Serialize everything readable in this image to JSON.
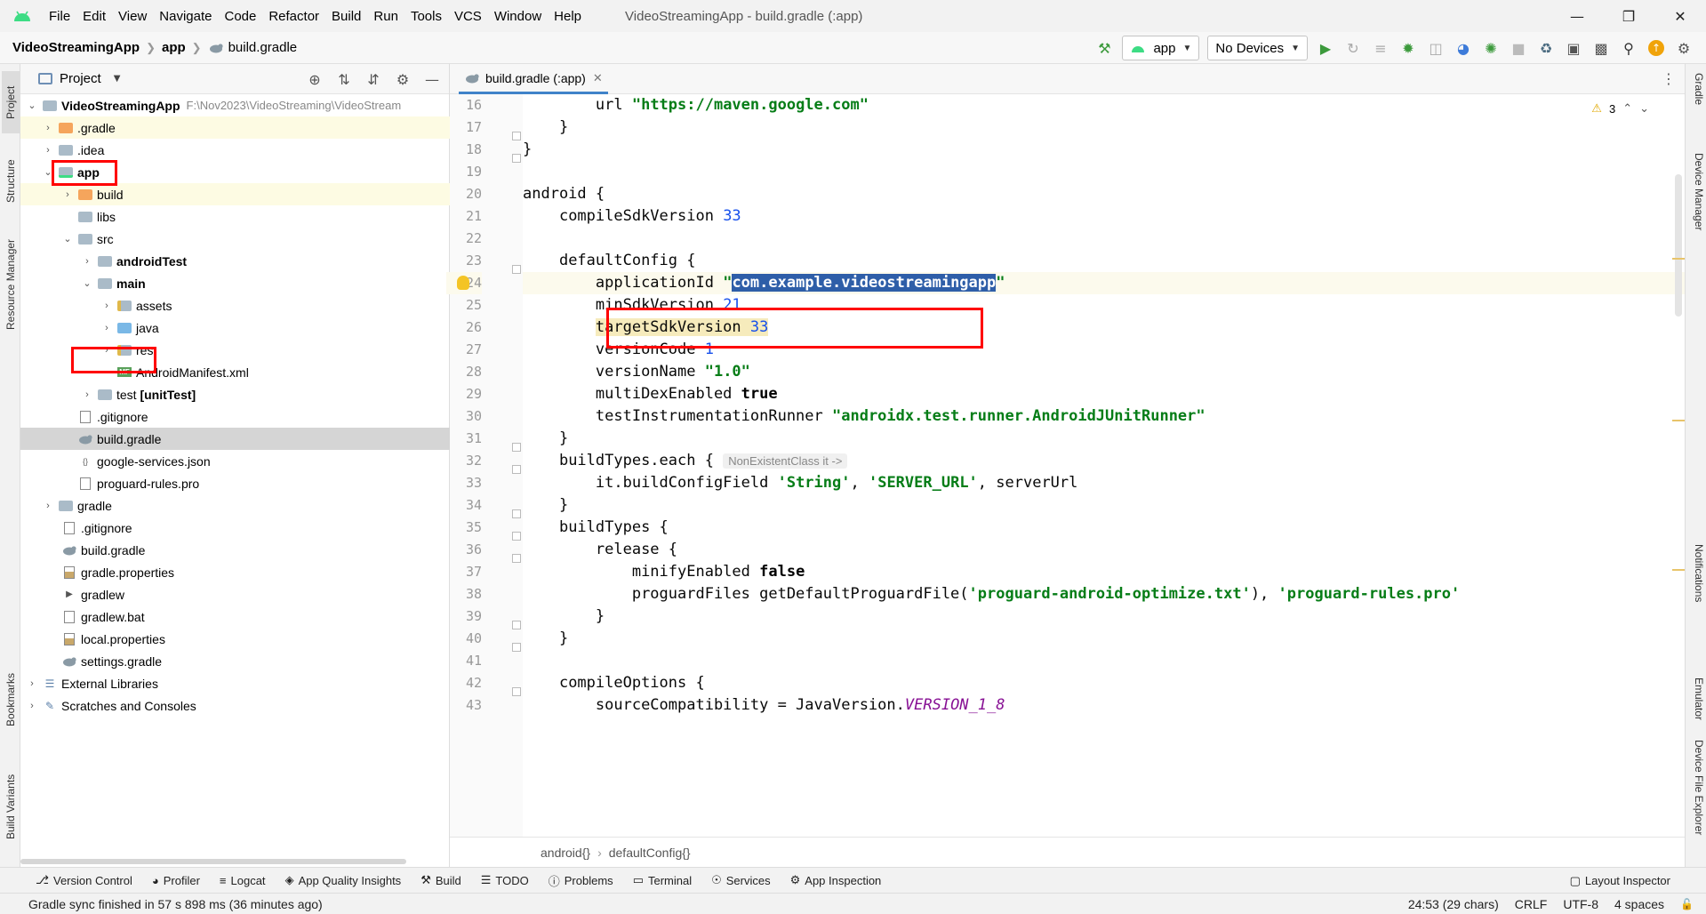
{
  "window": {
    "menu": [
      "File",
      "Edit",
      "View",
      "Navigate",
      "Code",
      "Refactor",
      "Build",
      "Run",
      "Tools",
      "VCS",
      "Window",
      "Help"
    ],
    "title": "VideoStreamingApp - build.gradle (:app)"
  },
  "navbar": {
    "project": "VideoStreamingApp",
    "module": "app",
    "file": "build.gradle",
    "run_config": "app",
    "device": "No Devices"
  },
  "left_stripe": [
    "Project",
    "Structure",
    "Resource Manager",
    "Bookmarks",
    "Build Variants"
  ],
  "right_stripe": [
    "Gradle",
    "Device Manager",
    "Notifications",
    "Emulator",
    "Device File Explorer"
  ],
  "project_panel": {
    "title": "Project",
    "root_path": "F:\\Nov2023\\VideoStreaming\\VideoStream",
    "tree": [
      {
        "label": "VideoStreamingApp",
        "bold": true
      },
      {
        "label": ".gradle"
      },
      {
        "label": ".idea"
      },
      {
        "label": "app",
        "bold": true
      },
      {
        "label": "build"
      },
      {
        "label": "libs"
      },
      {
        "label": "src"
      },
      {
        "label": "androidTest",
        "bold": true
      },
      {
        "label": "main",
        "bold": true
      },
      {
        "label": "assets"
      },
      {
        "label": "java"
      },
      {
        "label": "res"
      },
      {
        "label": "AndroidManifest.xml"
      },
      {
        "label": "test",
        "suffix": "[unitTest]"
      },
      {
        "label": ".gitignore"
      },
      {
        "label": "build.gradle"
      },
      {
        "label": "google-services.json"
      },
      {
        "label": "proguard-rules.pro"
      },
      {
        "label": "gradle"
      },
      {
        "label": ".gitignore"
      },
      {
        "label": "build.gradle"
      },
      {
        "label": "gradle.properties"
      },
      {
        "label": "gradlew"
      },
      {
        "label": "gradlew.bat"
      },
      {
        "label": "local.properties"
      },
      {
        "label": "settings.gradle"
      },
      {
        "label": "External Libraries"
      },
      {
        "label": "Scratches and Consoles"
      }
    ]
  },
  "editor": {
    "tab": "build.gradle (:app)",
    "warnings": "3",
    "line_numbers": [
      "16",
      "17",
      "18",
      "19",
      "20",
      "21",
      "22",
      "23",
      "24",
      "25",
      "26",
      "27",
      "28",
      "29",
      "30",
      "31",
      "32",
      "33",
      "34",
      "35",
      "36",
      "37",
      "38",
      "39",
      "40",
      "41",
      "42",
      "43"
    ],
    "code": {
      "l16a": "url ",
      "l16b": "\"https://maven.google.com\"",
      "l17": "}",
      "l18": "}",
      "l20": "android {",
      "l21a": "compileSdkVersion ",
      "l21b": "33",
      "l23": "defaultConfig {",
      "l24a": "applicationId ",
      "l24b": "\"",
      "l24c": "com.example.videostreamingapp",
      "l24d": "\"",
      "l25a": "minSdkVersion ",
      "l25b": "21",
      "l26a": "targetSdkVersion",
      "l26b": "33",
      "l27a": "versionCode ",
      "l27b": "1",
      "l28a": "versionName ",
      "l28b": "\"1.0\"",
      "l29a": "multiDexEnabled ",
      "l29b": "true",
      "l30a": "testInstrumentationRunner ",
      "l30b": "\"androidx.test.runner.AndroidJUnitRunner\"",
      "l31": "}",
      "l32a": "buildTypes.each { ",
      "l32hint": "NonExistentClass it ->",
      "l33a": "it.buildConfigField ",
      "l33b": "'String'",
      "l33c": ", ",
      "l33d": "'SERVER_URL'",
      "l33e": ", serverUrl",
      "l34": "}",
      "l35": "buildTypes {",
      "l36": "release {",
      "l37a": "minifyEnabled ",
      "l37b": "false",
      "l38a": "proguardFiles getDefaultProguardFile(",
      "l38b": "'proguard-android-optimize.txt'",
      "l38c": "), ",
      "l38d": "'proguard-rules.pro'",
      "l39": "}",
      "l40": "}",
      "l42": "compileOptions {",
      "l43a": "sourceCompatibility = JavaVersion.",
      "l43b": "VERSION_1_8"
    },
    "breadcrumb": [
      "android{}",
      "defaultConfig{}"
    ]
  },
  "bottom_tools": [
    "Version Control",
    "Profiler",
    "Logcat",
    "App Quality Insights",
    "Build",
    "TODO",
    "Problems",
    "Terminal",
    "Services",
    "App Inspection"
  ],
  "layout_inspector": "Layout Inspector",
  "status": {
    "message": "Gradle sync finished in 57 s 898 ms (36 minutes ago)",
    "position": "24:53 (29 chars)",
    "line_sep": "CRLF",
    "encoding": "UTF-8",
    "indent": "4 spaces"
  },
  "colors": {
    "accent": "#4083c9",
    "highlight_box": "#ff0000",
    "selection": "#2e5ea8"
  }
}
